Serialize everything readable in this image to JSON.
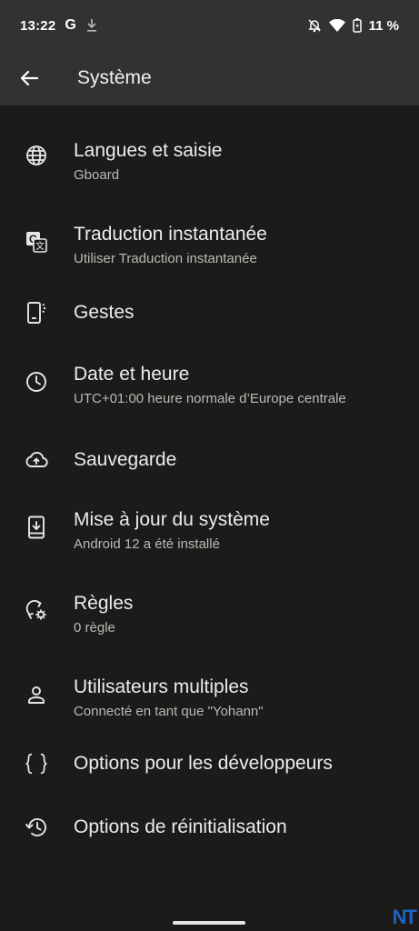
{
  "status": {
    "time": "13:22",
    "g_label": "G",
    "battery": "11 %"
  },
  "toolbar": {
    "title": "Système"
  },
  "items": [
    {
      "title": "Langues et saisie",
      "subtitle": "Gboard",
      "icon": "globe-icon"
    },
    {
      "title": "Traduction instantanée",
      "subtitle": "Utiliser Traduction instantanée",
      "icon": "translate-icon"
    },
    {
      "title": "Gestes",
      "subtitle": "",
      "icon": "gesture-phone-icon"
    },
    {
      "title": "Date et heure",
      "subtitle": "UTC+01:00 heure normale d’Europe centrale",
      "icon": "clock-icon"
    },
    {
      "title": "Sauvegarde",
      "subtitle": "",
      "icon": "cloud-upload-icon"
    },
    {
      "title": "Mise à jour du système",
      "subtitle": "Android 12 a été installé",
      "icon": "system-update-icon"
    },
    {
      "title": "Règles",
      "subtitle": "0 règle",
      "icon": "rules-icon"
    },
    {
      "title": "Utilisateurs multiples",
      "subtitle": "Connecté en tant que \"Yohann\"",
      "icon": "person-icon"
    },
    {
      "title": "Options pour les développeurs",
      "subtitle": "",
      "icon": "code-braces-icon"
    },
    {
      "title": "Options de réinitialisation",
      "subtitle": "",
      "icon": "reset-history-icon"
    }
  ],
  "watermark": "NT"
}
